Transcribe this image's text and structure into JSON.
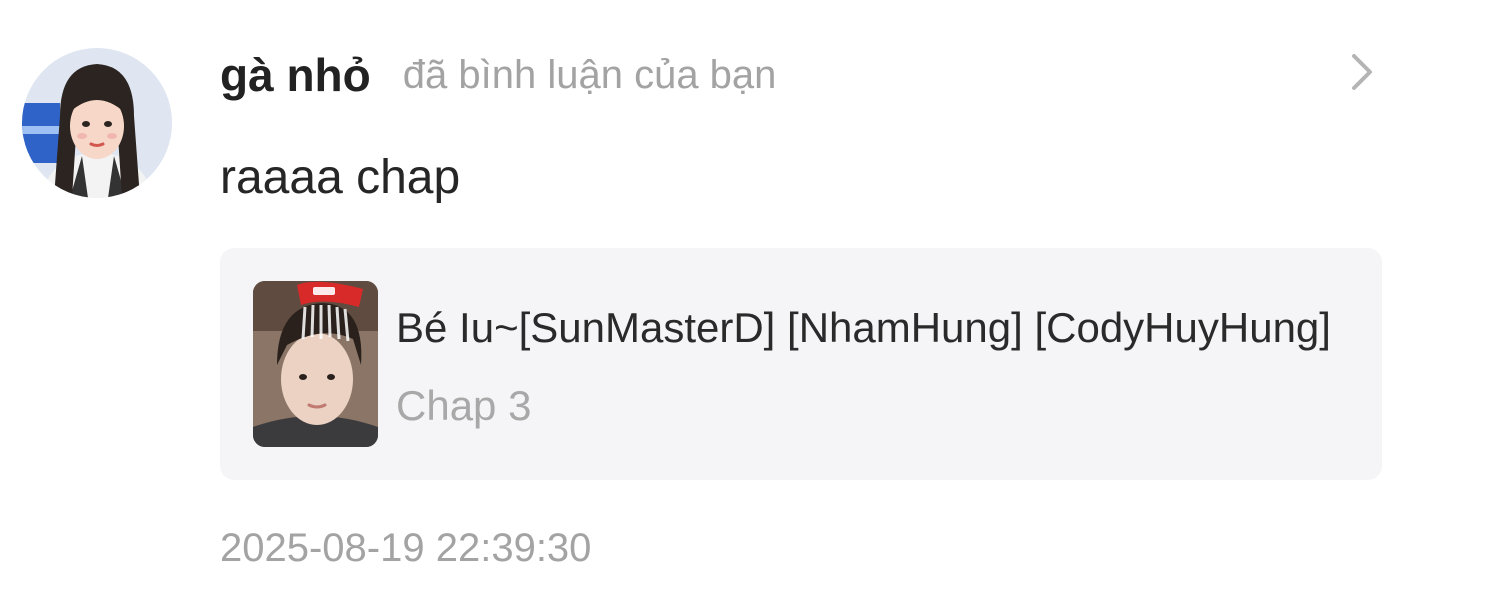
{
  "notification": {
    "username": "gà nhỏ",
    "action_text": "đã bình luận của bạn",
    "comment": "raaaa chap",
    "story": {
      "title": "Bé Iu~[SunMasterD] [NhamHung] [CodyHuyHung]",
      "chapter": "Chap 3"
    },
    "timestamp": "2025-08-19 22:39:30",
    "icons": {
      "avatar": "user-avatar-image",
      "cover": "story-cover-image",
      "chevron": "chevron-right-icon"
    },
    "colors": {
      "username": "#222222",
      "secondary_text": "#a3a3a3",
      "card_background": "#f5f5f7"
    }
  }
}
